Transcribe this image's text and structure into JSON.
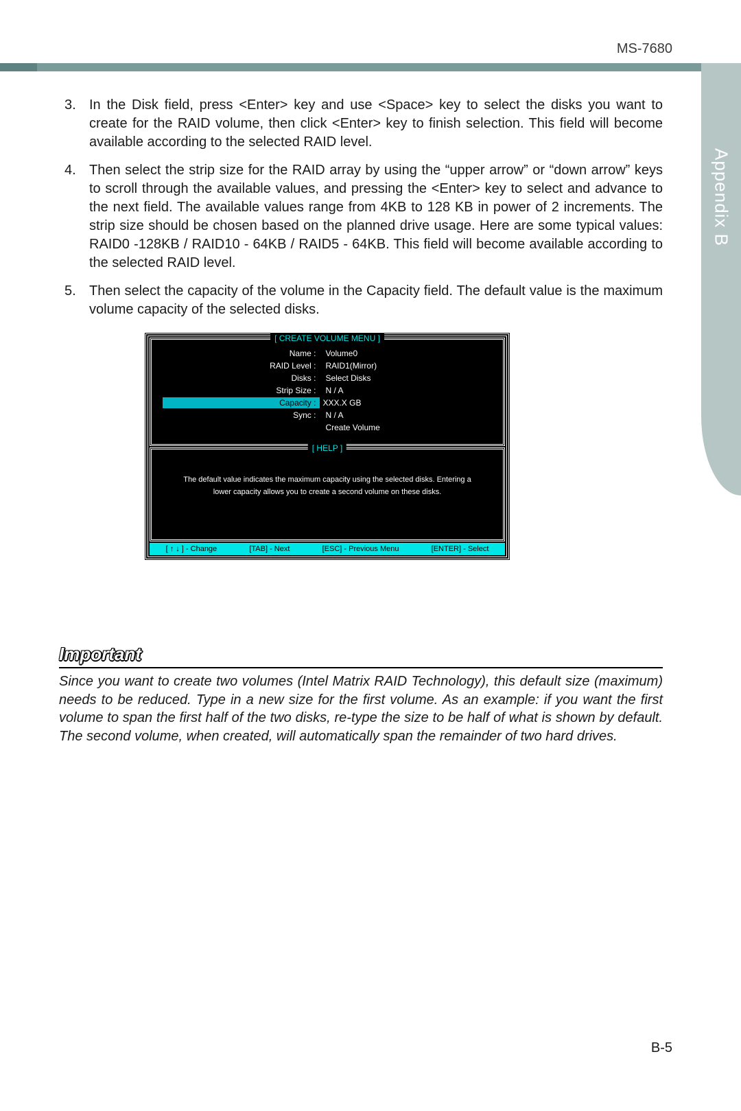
{
  "header": {
    "model": "MS-7680",
    "side_label": "Appendix B"
  },
  "list": {
    "item3_num": "3.",
    "item3": "In the Disk field, press <Enter> key and use <Space> key to select the disks you want to create for the RAID volume, then click <Enter> key to finish selection. This field will become available according to the selected RAID level.",
    "item4_num": "4.",
    "item4": "Then select the strip size for the RAID array by using the “upper arrow” or “down arrow” keys to scroll through the available values, and pressing the <Enter> key to select and advance to the next field. The available values range from 4KB to 128 KB in power of 2 increments. The strip size should be chosen based on the planned drive usage. Here are some typical values: RAID0 -128KB / RAID10 - 64KB / RAID5 - 64KB. This field will become available according to the selected RAID level.",
    "item5_num": "5.",
    "item5": "Then select the capacity of the volume in the Capacity field. The default value is the maximum volume capacity of the selected disks."
  },
  "bios": {
    "menu_title": "[  CREATE VOLUME MENU  ]",
    "help_title": "[     HELP     ]",
    "rows": {
      "name_l": "Name :",
      "name_v": "Volume0",
      "raid_l": "RAID Level :",
      "raid_v": "RAID1(Mirror)",
      "disks_l": "Disks :",
      "disks_v": "Select Disks",
      "strip_l": "Strip Size :",
      "strip_v": "N / A",
      "cap_l": "Capacity :",
      "cap_v": "XXX.X  GB",
      "sync_l": "Sync :",
      "sync_v": "N / A",
      "create_v": "Create Volume"
    },
    "help_text": "The default value indicates the maximum capacity using the selected disks. Entering a lower capacity allows you to create a second volume on these disks.",
    "footer": {
      "change": "[ ↑ ↓ ] - Change",
      "tab": "[TAB] - Next",
      "esc": "[ESC] - Previous Menu",
      "enter": "[ENTER] - Select"
    }
  },
  "important": {
    "heading": "Important",
    "body": "Since you want to create two volumes (Intel Matrix RAID Technology), this default size (maximum) needs to be reduced. Type in a new size for the first volume. As an example: if you want the first volume to span the first half of the two disks, re-type the size to be half of what is shown by default. The second volume, when created, will automatically span the remainder of two hard drives."
  },
  "page_number": "B-5"
}
